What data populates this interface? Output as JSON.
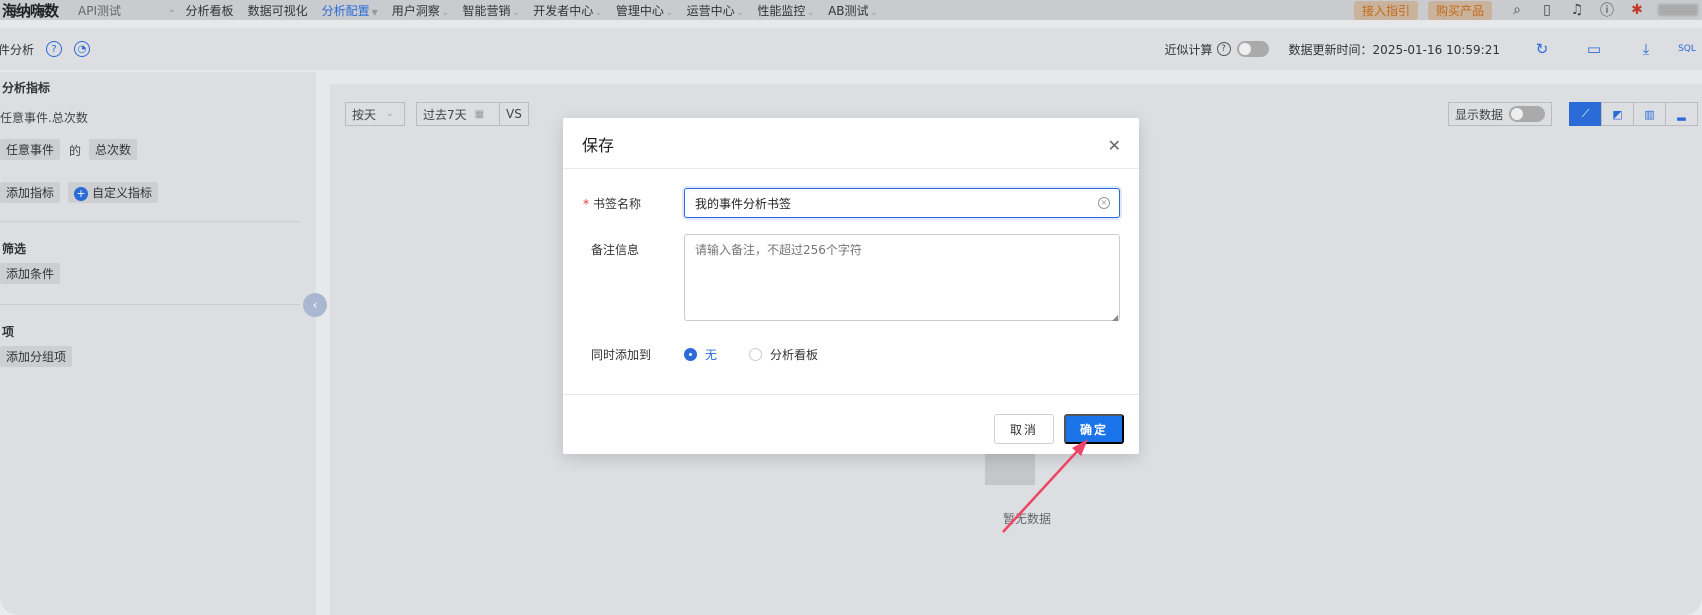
{
  "nav": {
    "logo": "海纳嗨数",
    "api": "API测试",
    "items": [
      {
        "label": "分析看板",
        "caret": false,
        "active": false
      },
      {
        "label": "数据可视化",
        "caret": false,
        "active": false
      },
      {
        "label": "分析配置",
        "caret": true,
        "active": true
      },
      {
        "label": "用户洞察",
        "caret": true,
        "active": false
      },
      {
        "label": "智能营销",
        "caret": true,
        "active": false
      },
      {
        "label": "开发者中心",
        "caret": true,
        "active": false
      },
      {
        "label": "管理中心",
        "caret": true,
        "active": false
      },
      {
        "label": "运营中心",
        "caret": true,
        "active": false
      },
      {
        "label": "性能监控",
        "caret": true,
        "active": false
      },
      {
        "label": "AB测试",
        "caret": true,
        "active": false
      }
    ],
    "access_guide": "接入指引",
    "buy_product": "购买产品"
  },
  "toolbar": {
    "title": "件分析",
    "approx_calc": "近似计算",
    "update_time": "数据更新时间：2025-01-16 10:59:21"
  },
  "left": {
    "metrics_title": "分析指标",
    "metric_summary": "任意事件.总次数",
    "event_chip": "任意事件",
    "of_text": "的",
    "count_chip": "总次数",
    "add_metric": "添加指标",
    "custom_metric": "自定义指标",
    "filter_title": "筛选",
    "add_condition": "添加条件",
    "group_title": "项",
    "add_group": "添加分组项"
  },
  "main": {
    "granularity": "按天",
    "date_range": "过去7天",
    "vs": "VS",
    "show_data": "显示数据",
    "empty_text": "暂无数据"
  },
  "modal": {
    "title": "保存",
    "bookmark_label": "书签名称",
    "bookmark_value": "我的事件分析书签",
    "note_label": "备注信息",
    "note_placeholder": "请输入备注，不超过256个字符",
    "also_add_label": "同时添加到",
    "option_none": "无",
    "option_dashboard": "分析看板",
    "cancel": "取消",
    "confirm": "确定"
  },
  "colors": {
    "accent": "#1a73e8",
    "required": "#e53935",
    "arrow": "#ee4466"
  }
}
